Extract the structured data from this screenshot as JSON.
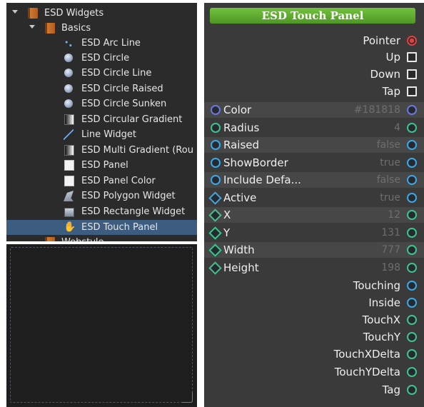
{
  "tree": {
    "items": [
      {
        "label": "ESD Widgets",
        "icon": "book-icon",
        "level": 0,
        "expanded": true
      },
      {
        "label": "Basics",
        "icon": "book-icon",
        "level": 1,
        "expanded": true
      },
      {
        "label": "ESD Arc Line",
        "icon": "arc-line-icon",
        "level": 2
      },
      {
        "label": "ESD Circle",
        "icon": "circle-icon",
        "level": 2
      },
      {
        "label": "ESD Circle Line",
        "icon": "circle-icon",
        "level": 2
      },
      {
        "label": "ESD Circle Raised",
        "icon": "circle-icon",
        "level": 2
      },
      {
        "label": "ESD Circle Sunken",
        "icon": "circle-icon",
        "level": 2
      },
      {
        "label": "ESD Circular Gradient",
        "icon": "gradient-icon",
        "level": 2
      },
      {
        "label": "Line Widget",
        "icon": "line-icon",
        "level": 2
      },
      {
        "label": "ESD Multi Gradient (Rou",
        "icon": "gradient-icon",
        "level": 2
      },
      {
        "label": "ESD Panel",
        "icon": "panel-icon",
        "level": 2
      },
      {
        "label": "ESD Panel Color",
        "icon": "panel-icon",
        "level": 2
      },
      {
        "label": "ESD Polygon Widget",
        "icon": "polygon-icon",
        "level": 2
      },
      {
        "label": "ESD Rectangle Widget",
        "icon": "rectangle-icon",
        "level": 2
      },
      {
        "label": "ESD Touch Panel",
        "icon": "hand-icon",
        "level": 2,
        "selected": true
      },
      {
        "label": "Webstyle",
        "icon": "book-icon",
        "level": 1
      }
    ]
  },
  "node": {
    "title": "ESD Touch Panel",
    "outputs_top": [
      {
        "label": "Pointer",
        "port": "red-circle"
      },
      {
        "label": "Up",
        "port": "checkbox"
      },
      {
        "label": "Down",
        "port": "checkbox"
      },
      {
        "label": "Tap",
        "port": "checkbox"
      }
    ],
    "properties": [
      {
        "label": "Color",
        "value": "#181818",
        "left_port": "navy-circle",
        "right_port": "navy-circle"
      },
      {
        "label": "Radius",
        "value": "4",
        "left_port": "green-circle",
        "right_port": "green-circle"
      },
      {
        "label": "Raised",
        "value": "false",
        "left_port": "blue-circle",
        "right_port": "blue-circle"
      },
      {
        "label": "ShowBorder",
        "value": "true",
        "left_port": "blue-circle",
        "right_port": "blue-circle"
      },
      {
        "label": "Include Defa...",
        "value": "false",
        "left_port": "blue-circle",
        "right_port": "blue-circle"
      },
      {
        "label": "Active",
        "value": "true",
        "left_port": "blue-diamond",
        "right_port": "blue-circle"
      },
      {
        "label": "X",
        "value": "12",
        "left_port": "green-diamond",
        "right_port": "green-circle"
      },
      {
        "label": "Y",
        "value": "131",
        "left_port": "green-diamond",
        "right_port": "green-circle"
      },
      {
        "label": "Width",
        "value": "777",
        "left_port": "green-diamond",
        "right_port": "green-circle"
      },
      {
        "label": "Height",
        "value": "198",
        "left_port": "green-diamond",
        "right_port": "green-circle"
      }
    ],
    "outputs_bottom": [
      {
        "label": "Touching",
        "port": "blue-circle"
      },
      {
        "label": "Inside",
        "port": "blue-circle"
      },
      {
        "label": "TouchX",
        "port": "green-circle"
      },
      {
        "label": "TouchY",
        "port": "green-circle"
      },
      {
        "label": "TouchXDelta",
        "port": "green-circle"
      },
      {
        "label": "TouchYDelta",
        "port": "green-circle"
      },
      {
        "label": "Tag",
        "port": "green-circle"
      }
    ]
  }
}
